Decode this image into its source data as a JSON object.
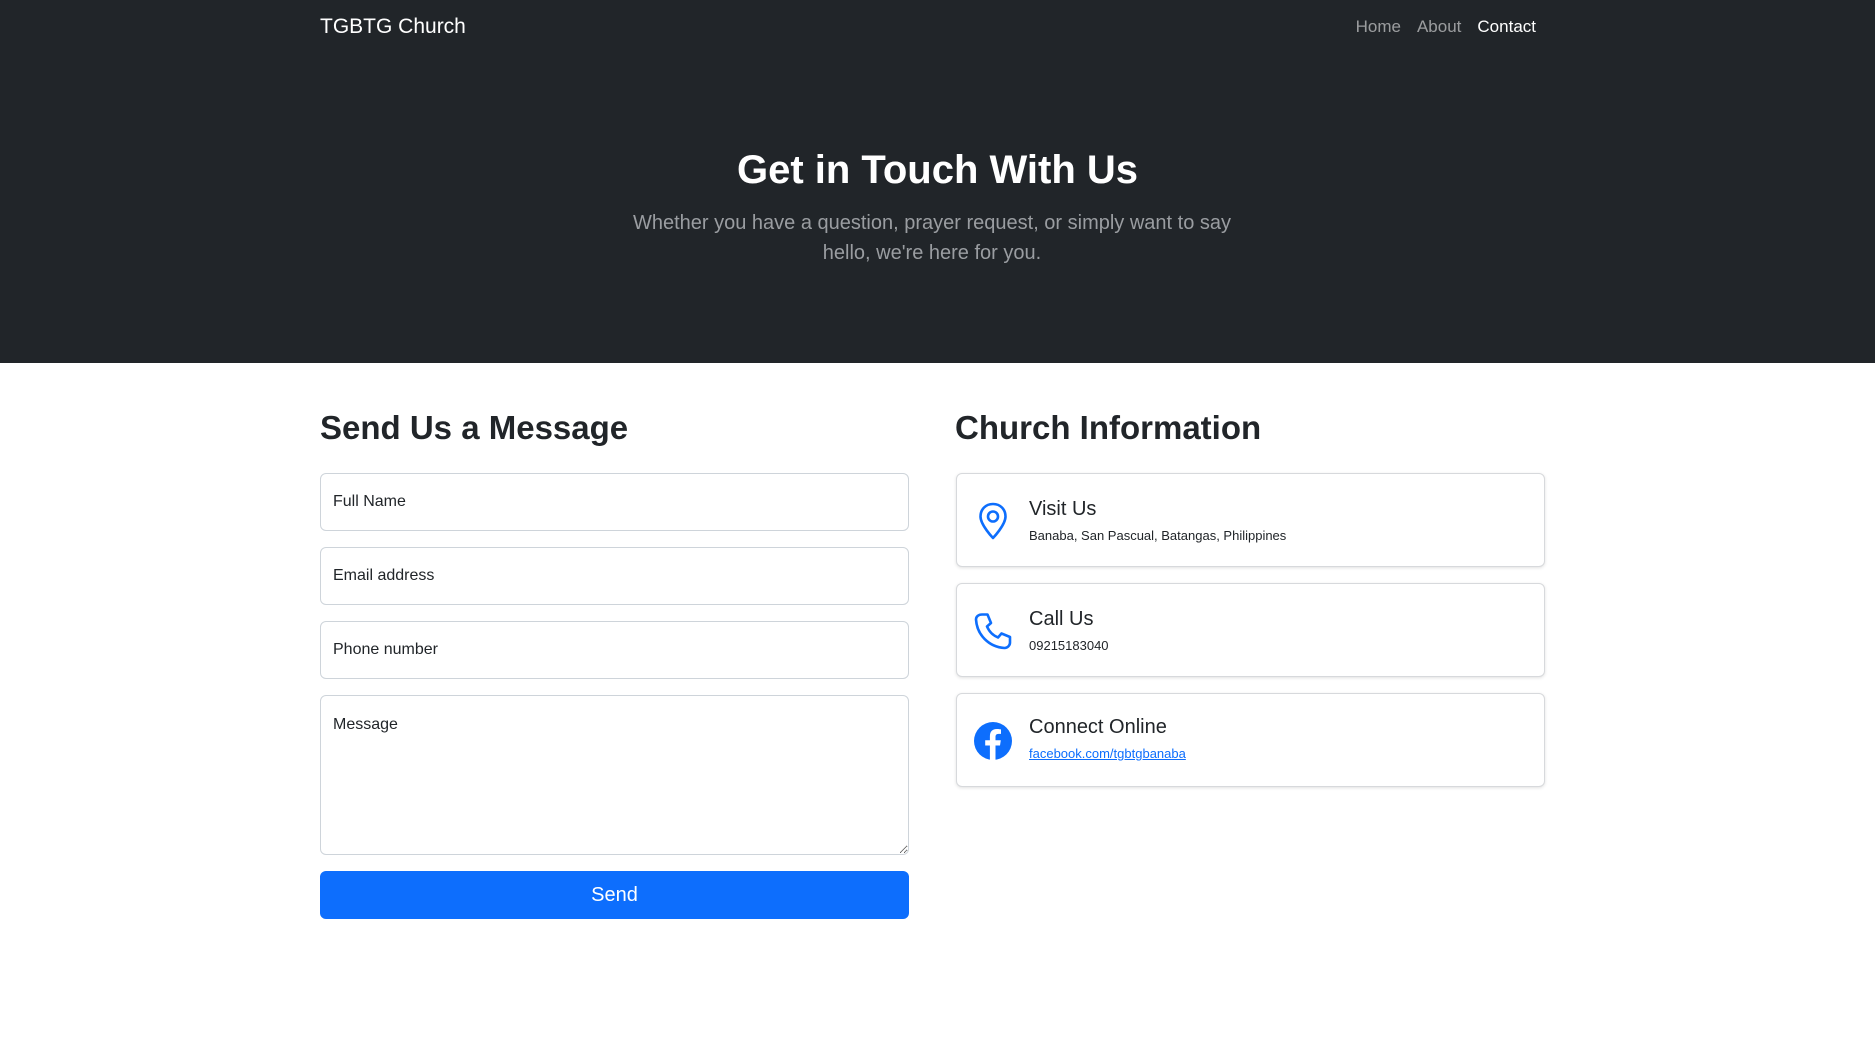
{
  "navbar": {
    "brand": "TGBTG Church",
    "links": [
      {
        "label": "Home"
      },
      {
        "label": "About"
      },
      {
        "label": "Contact"
      }
    ]
  },
  "hero": {
    "title": "Get in Touch With Us",
    "subtitle": "Whether you have a question, prayer request, or simply want to say hello, we're here for you."
  },
  "form": {
    "title": "Send Us a Message",
    "name_placeholder": "Full Name",
    "email_placeholder": "Email address",
    "phone_placeholder": "Phone number",
    "message_placeholder": "Message",
    "send_label": "Send"
  },
  "info": {
    "title": "Church Information",
    "cards": [
      {
        "icon": "map-pin-icon",
        "title": "Visit Us",
        "detail": "Banaba, San Pascual, Batangas, Philippines"
      },
      {
        "icon": "phone-icon",
        "title": "Call Us",
        "detail": "09215183040"
      },
      {
        "icon": "facebook-icon",
        "title": "Connect Online",
        "detail": "facebook.com/tgbtgbanaba"
      }
    ]
  },
  "colors": {
    "dark": "#212529",
    "primary": "#0d6efd",
    "muted": "#9a9da1"
  }
}
